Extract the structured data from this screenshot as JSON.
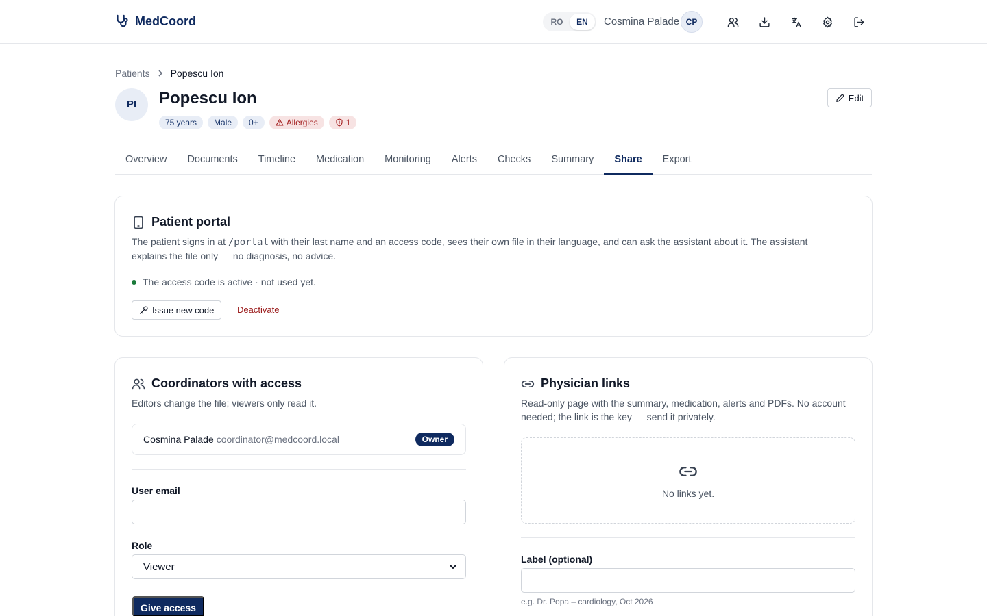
{
  "app": {
    "name": "MedCoord"
  },
  "topbar": {
    "languages": [
      "RO",
      "EN"
    ],
    "active_language": "EN",
    "user_name": "Cosmina Palade",
    "user_initials": "CP",
    "icons": [
      "users-icon",
      "download-icon",
      "translate-icon",
      "gear-icon",
      "logout-icon"
    ]
  },
  "breadcrumb": {
    "parent": "Patients",
    "current": "Popescu Ion"
  },
  "patient": {
    "initials": "PI",
    "name": "Popescu Ion",
    "age": "75 years",
    "sex": "Male",
    "blood": "0+",
    "allergies": "Allergies",
    "shield_count": "1"
  },
  "header": {
    "edit_label": "Edit"
  },
  "tabs": [
    {
      "label": "Overview"
    },
    {
      "label": "Documents"
    },
    {
      "label": "Timeline"
    },
    {
      "label": "Medication"
    },
    {
      "label": "Monitoring"
    },
    {
      "label": "Alerts"
    },
    {
      "label": "Checks"
    },
    {
      "label": "Summary"
    },
    {
      "label": "Share",
      "active": true
    },
    {
      "label": "Export"
    }
  ],
  "portal": {
    "title": "Patient portal",
    "desc_before": "The patient signs in at ",
    "desc_code": "/portal",
    "desc_after": " with their last name and an access code, sees their own file in their language, and can ask the assistant about it. The assistant explains the file only — no diagnosis, no advice.",
    "status": "The access code is active · not used yet.",
    "issue_label": "Issue new code",
    "deactivate_label": "Deactivate"
  },
  "coordinators": {
    "title": "Coordinators with access",
    "desc": "Editors change the file; viewers only read it.",
    "member_name": "Cosmina Palade",
    "member_email": "coordinator@medcoord.local",
    "member_role": "Owner",
    "email_label": "User email",
    "email_value": "",
    "role_label": "Role",
    "role_value": "Viewer",
    "submit_label": "Give access"
  },
  "links": {
    "title": "Physician links",
    "desc": "Read-only page with the summary, medication, alerts and PDFs. No account needed; the link is the key — send it privately.",
    "empty": "No links yet.",
    "label_label": "Label (optional)",
    "label_value": "",
    "hint": "e.g. Dr. Popa – cardiology, Oct 2026"
  },
  "colors": {
    "brand": "#0f2a5f",
    "danger": "#9b1c1c",
    "active_status": "#1b7a3a"
  }
}
